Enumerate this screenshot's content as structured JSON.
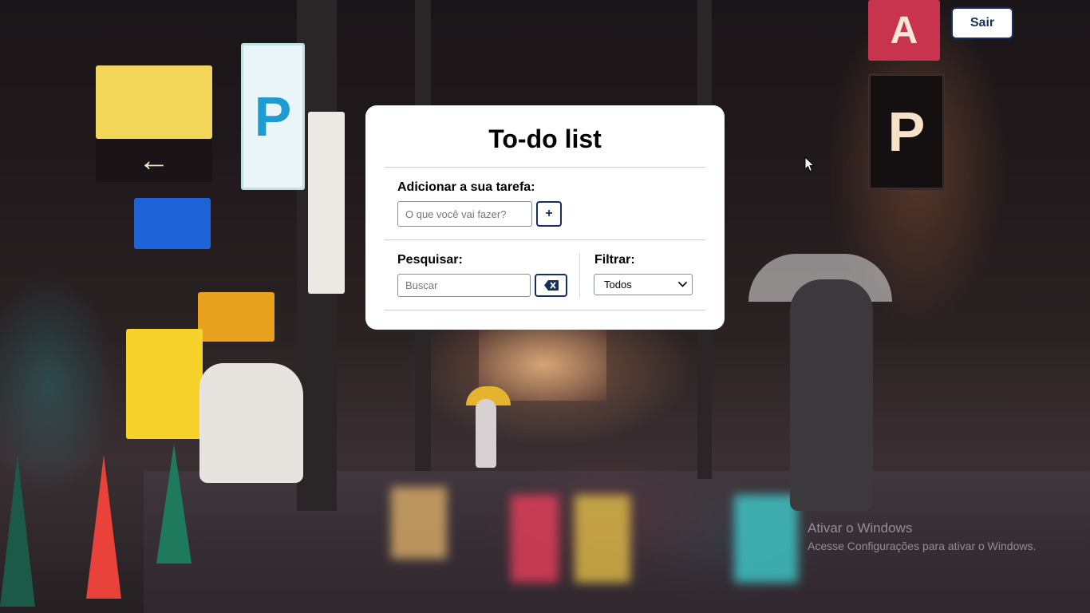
{
  "header": {
    "logout_label": "Sair"
  },
  "todo": {
    "title": "To-do list",
    "add": {
      "label": "Adicionar a sua tarefa:",
      "placeholder": "O que você vai fazer?",
      "button_label": "+"
    },
    "search": {
      "label": "Pesquisar:",
      "placeholder": "Buscar",
      "clear_icon": "backspace-icon"
    },
    "filter": {
      "label": "Filtrar:",
      "selected": "Todos"
    }
  },
  "watermark": {
    "title": "Ativar o Windows",
    "subtitle": "Acesse Configurações para ativar o Windows."
  },
  "colors": {
    "accent": "#15305c",
    "card_bg": "#ffffff"
  }
}
